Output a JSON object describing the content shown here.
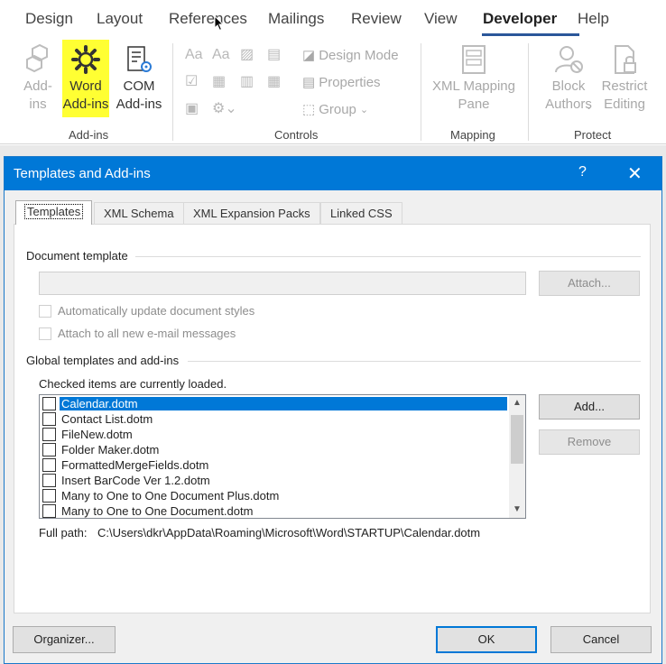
{
  "ribbon_tabs": [
    "Design",
    "Layout",
    "References",
    "Mailings",
    "Review",
    "View",
    "Developer",
    "Help"
  ],
  "active_tab": "Developer",
  "ribbon": {
    "addins_group": {
      "label": "Add-ins",
      "addins": "Add-\nins",
      "word_addins": "Word\nAdd-ins",
      "com_addins": "COM\nAdd-ins"
    },
    "controls_group": {
      "label": "Controls",
      "design_mode": "Design Mode",
      "properties": "Properties",
      "group": "Group"
    },
    "mapping_group": {
      "label": "Mapping",
      "xml_mapping": "XML Mapping\nPane"
    },
    "protect_group": {
      "label": "Protect",
      "block_authors": "Block\nAuthors",
      "restrict_editing": "Restrict\nEditing"
    }
  },
  "dialog": {
    "title": "Templates and Add-ins",
    "help": "?",
    "close": "✕",
    "tabs": [
      "Templates",
      "XML Schema",
      "XML Expansion Packs",
      "Linked CSS"
    ],
    "document_template_label": "Document template",
    "template_value": "",
    "attach_button": "Attach...",
    "auto_update_label": "Automatically update document styles",
    "attach_email_label": "Attach to all new e-mail messages",
    "global_label": "Global templates and add-ins",
    "checked_note": "Checked items are currently loaded.",
    "items": [
      {
        "name": "Calendar.dotm",
        "selected": true
      },
      {
        "name": "Contact List.dotm",
        "selected": false
      },
      {
        "name": "FileNew.dotm",
        "selected": false
      },
      {
        "name": "Folder Maker.dotm",
        "selected": false
      },
      {
        "name": "FormattedMergeFields.dotm",
        "selected": false
      },
      {
        "name": "Insert BarCode Ver 1.2.dotm",
        "selected": false
      },
      {
        "name": "Many to One to One Document Plus.dotm",
        "selected": false
      },
      {
        "name": "Many to One to One Document.dotm",
        "selected": false
      }
    ],
    "add_button": "Add...",
    "remove_button": "Remove",
    "full_path_label": "Full path:",
    "full_path_value": "C:\\Users\\dkr\\AppData\\Roaming\\Microsoft\\Word\\STARTUP\\Calendar.dotm",
    "organizer_button": "Organizer...",
    "ok_button": "OK",
    "cancel_button": "Cancel"
  },
  "colors": {
    "accent": "#0078d7",
    "highlight": "#ffff33",
    "developer_underline": "#2b579a"
  }
}
